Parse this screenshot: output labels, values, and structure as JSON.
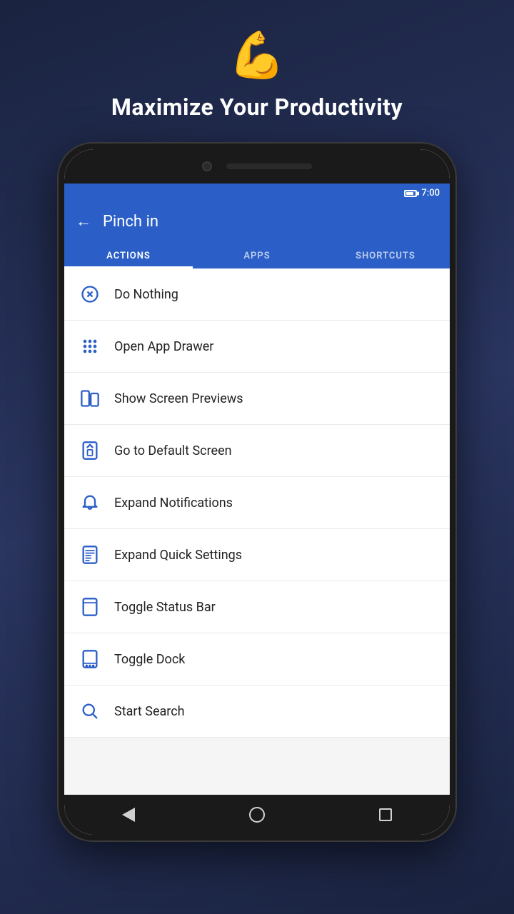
{
  "header": {
    "emoji": "💪",
    "tagline": "Maximize Your Productivity"
  },
  "status_bar": {
    "time": "7:00"
  },
  "app_bar": {
    "title": "Pinch in",
    "back_label": "←"
  },
  "tabs": [
    {
      "id": "actions",
      "label": "ACTIONS",
      "active": true
    },
    {
      "id": "apps",
      "label": "APPS",
      "active": false
    },
    {
      "id": "shortcuts",
      "label": "SHORTCUTS",
      "active": false
    }
  ],
  "actions": [
    {
      "id": "do-nothing",
      "label": "Do Nothing",
      "icon": "x-circle"
    },
    {
      "id": "open-app-drawer",
      "label": "Open App Drawer",
      "icon": "grid"
    },
    {
      "id": "show-screen-previews",
      "label": "Show Screen Previews",
      "icon": "screen-preview"
    },
    {
      "id": "go-to-default-screen",
      "label": "Go to Default Screen",
      "icon": "home-screen"
    },
    {
      "id": "expand-notifications",
      "label": "Expand Notifications",
      "icon": "bell"
    },
    {
      "id": "expand-quick-settings",
      "label": "Expand Quick Settings",
      "icon": "quick-settings"
    },
    {
      "id": "toggle-status-bar",
      "label": "Toggle Status Bar",
      "icon": "status-bar"
    },
    {
      "id": "toggle-dock",
      "label": "Toggle Dock",
      "icon": "dock"
    },
    {
      "id": "start-search",
      "label": "Start Search",
      "icon": "search"
    }
  ],
  "bottom_nav": {
    "back": "back",
    "home": "home",
    "recents": "recents"
  }
}
